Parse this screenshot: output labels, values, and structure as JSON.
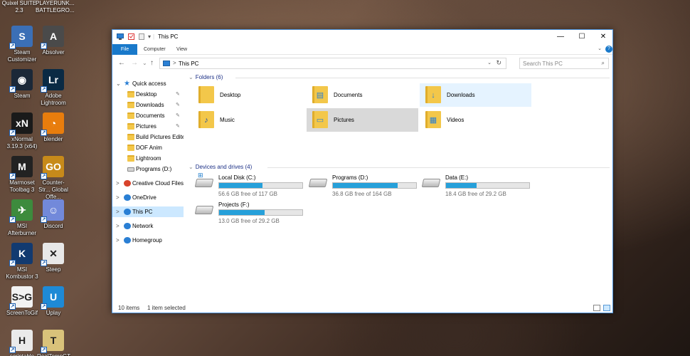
{
  "desktop": {
    "top_labels": [
      "Quixel SUITE 2.3",
      "PLAYERUNK... BATTLEGRO..."
    ],
    "icons": [
      {
        "label": "Steam Customizer",
        "icon": "steam-customizer-icon",
        "color": "#3b6fb6",
        "glyph": "S"
      },
      {
        "label": "Absolver",
        "icon": "absolver-icon",
        "color": "#4a4a4a",
        "glyph": "A"
      },
      {
        "label": "Steam",
        "icon": "steam-icon",
        "color": "#1b2838",
        "glyph": "◉"
      },
      {
        "label": "Adobe Lightroom",
        "icon": "lightroom-icon",
        "color": "#0a2a44",
        "glyph": "Lr"
      },
      {
        "label": "xNormal 3.19.3 (x64)",
        "icon": "xnormal-icon",
        "color": "#1a1a1a",
        "glyph": "xN"
      },
      {
        "label": "blender",
        "icon": "blender-icon",
        "color": "#e87d0d",
        "glyph": "◔"
      },
      {
        "label": "Marmoset Toolbag 3",
        "icon": "marmoset-icon",
        "color": "#222",
        "glyph": "M"
      },
      {
        "label": "Counter-Str... Global Offe...",
        "icon": "csgo-icon",
        "color": "#c78a1a",
        "glyph": "GO"
      },
      {
        "label": "MSI Afterburner",
        "icon": "msi-afterburner-icon",
        "color": "#3d8b3d",
        "glyph": "✈"
      },
      {
        "label": "Discord",
        "icon": "discord-icon",
        "color": "#7289da",
        "glyph": "☺"
      },
      {
        "label": "MSI Kombustor 3",
        "icon": "msi-kombustor-icon",
        "color": "#123a70",
        "glyph": "K"
      },
      {
        "label": "Steep",
        "icon": "steep-icon",
        "color": "#e8e8e8",
        "glyph": "✕"
      },
      {
        "label": "ScreenToGif",
        "icon": "screentogif-icon",
        "color": "#f2f2f2",
        "glyph": "S>G"
      },
      {
        "label": "Uplay",
        "icon": "uplay-icon",
        "color": "#1e8ad6",
        "glyph": "U"
      },
      {
        "label": "scriptable",
        "icon": "scriptable-icon",
        "color": "#eaeaea",
        "glyph": "H"
      },
      {
        "label": "RealTempGT",
        "icon": "realtemp-icon",
        "color": "#d9c27a",
        "glyph": "T"
      }
    ]
  },
  "window": {
    "title": "This PC",
    "quick_access_arrow": "▾",
    "controls": {
      "minimize": "—",
      "maximize": "☐",
      "close": "✕"
    },
    "ribbon": {
      "tabs": [
        "File",
        "Computer",
        "View"
      ],
      "collapse": "⌄",
      "help": "?"
    },
    "address": {
      "back": "←",
      "forward": "→",
      "recent": "⌄",
      "up": "↑",
      "separator": ">",
      "path": "This PC",
      "dropdown": "⌄",
      "refresh": "↻",
      "search_placeholder": "Search This PC",
      "search_icon": "⌕"
    },
    "nav_pane": {
      "quick_access": "Quick access",
      "pinned": [
        {
          "label": "Desktop",
          "pinned": true
        },
        {
          "label": "Downloads",
          "pinned": true
        },
        {
          "label": "Documents",
          "pinned": true
        },
        {
          "label": "Pictures",
          "pinned": true
        },
        {
          "label": "Build Pictures Editer",
          "pinned": false
        },
        {
          "label": "DOF Anim",
          "pinned": false
        },
        {
          "label": "Lightroom",
          "pinned": false
        },
        {
          "label": "Programs (D:)",
          "pinned": false
        }
      ],
      "roots": [
        "Creative Cloud Files",
        "OneDrive",
        "This PC",
        "Network",
        "Homegroup"
      ],
      "selected": "This PC",
      "pin_glyph": "✎",
      "chev_right": ">",
      "chev_down": "⌄"
    },
    "folders_header": "Folders (6)",
    "folders": [
      {
        "name": "Desktop",
        "overlay": "",
        "state": "normal"
      },
      {
        "name": "Documents",
        "overlay": "▤",
        "state": "normal"
      },
      {
        "name": "Downloads",
        "overlay": "↓",
        "state": "hover"
      },
      {
        "name": "Music",
        "overlay": "♪",
        "state": "normal"
      },
      {
        "name": "Pictures",
        "overlay": "▭",
        "state": "selected"
      },
      {
        "name": "Videos",
        "overlay": "▦",
        "state": "normal"
      }
    ],
    "drives_header": "Devices and drives (4)",
    "drives": [
      {
        "name": "Local Disk (C:)",
        "free": "56.6 GB free of 117 GB",
        "used_fraction": 0.52,
        "system": true
      },
      {
        "name": "Programs (D:)",
        "free": "36.8 GB free of 164 GB",
        "used_fraction": 0.78,
        "system": false
      },
      {
        "name": "Data (E:)",
        "free": "18.4 GB free of 29.2 GB",
        "used_fraction": 0.37,
        "system": false
      },
      {
        "name": "Projects (F:)",
        "free": "13.0 GB free of 29.2 GB",
        "used_fraction": 0.55,
        "system": false
      }
    ],
    "status": {
      "items": "10 items",
      "selected": "1 item selected"
    }
  },
  "colors": {
    "accent": "#1979ca",
    "drive_bar": "#26a0da",
    "selection": "#cce8ff",
    "header_text": "#1e3287"
  }
}
